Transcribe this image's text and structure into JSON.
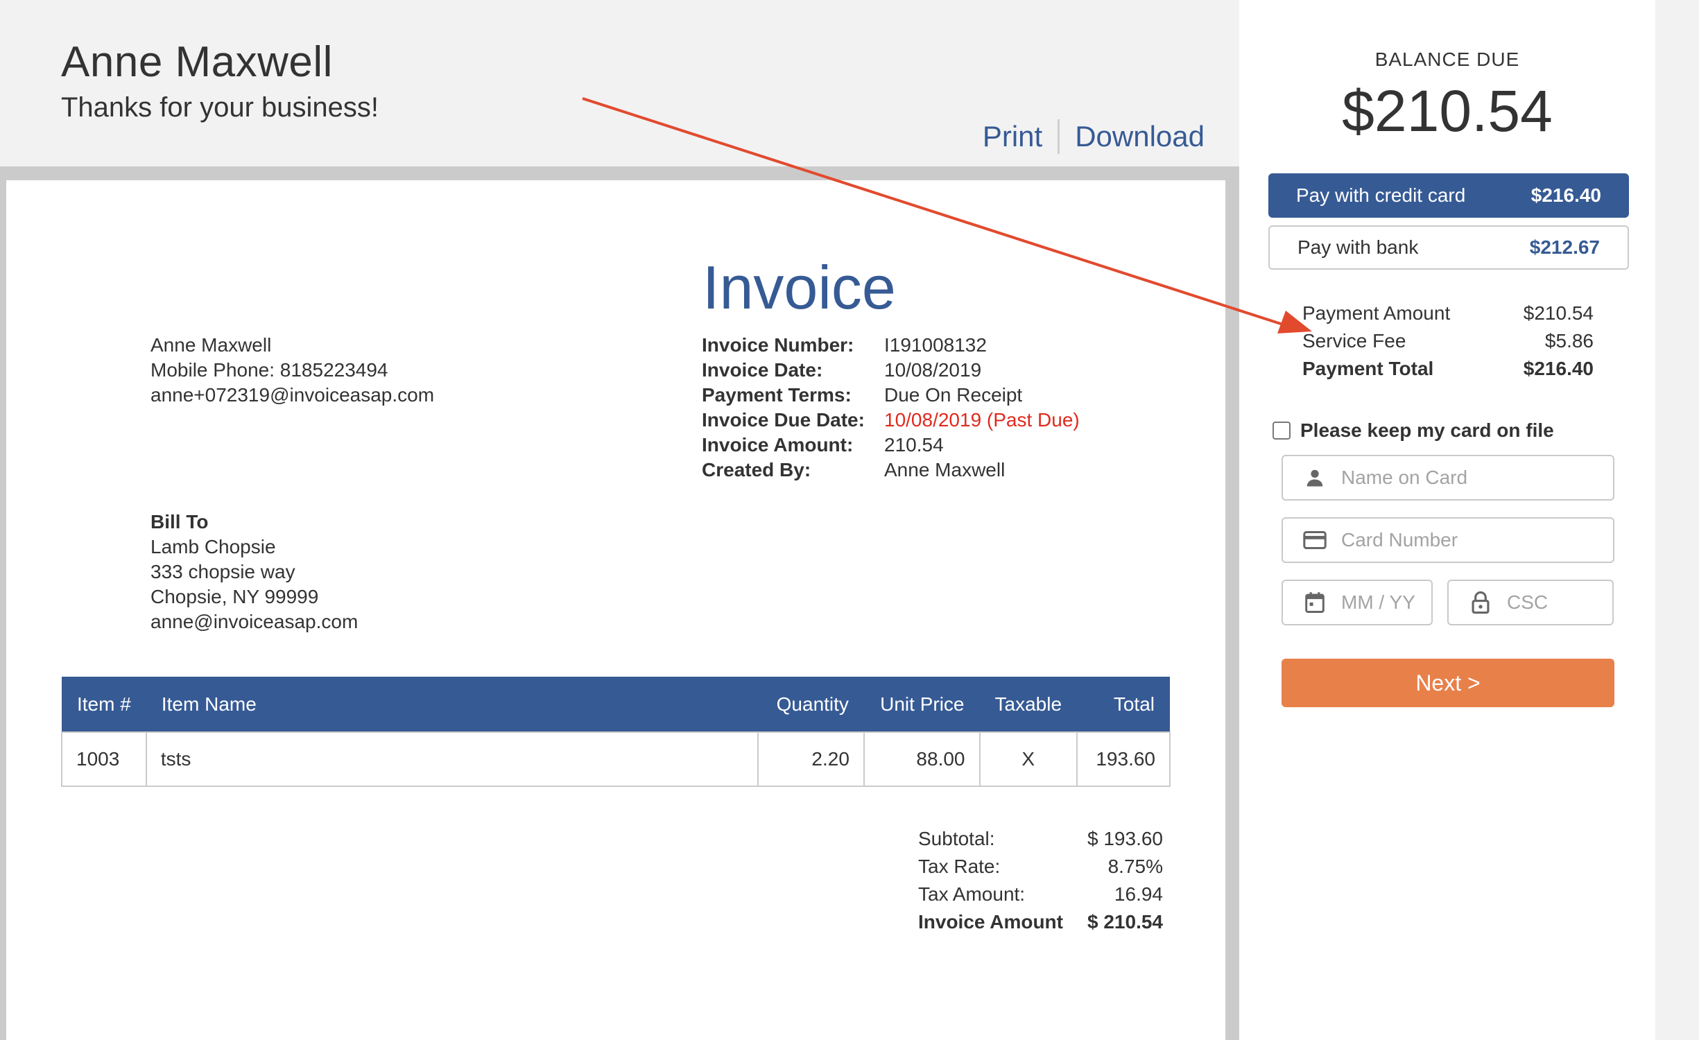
{
  "header": {
    "business_name": "Anne Maxwell",
    "tagline": "Thanks for your business!",
    "print_label": "Print",
    "download_label": "Download"
  },
  "invoice": {
    "title": "Invoice",
    "from": {
      "name": "Anne Maxwell",
      "phone": "Mobile Phone: 8185223494",
      "email": "anne+072319@invoiceasap.com"
    },
    "meta": [
      {
        "label": "Invoice Number:",
        "value": "I191008132"
      },
      {
        "label": "Invoice Date:",
        "value": "10/08/2019"
      },
      {
        "label": "Payment Terms:",
        "value": "Due On Receipt"
      },
      {
        "label": "Invoice Due Date:",
        "value": "10/08/2019 (Past Due)"
      },
      {
        "label": "Invoice Amount:",
        "value": "210.54"
      },
      {
        "label": "Created By:",
        "value": "Anne Maxwell"
      }
    ],
    "bill_to": {
      "heading": "Bill To",
      "name": "Lamb Chopsie",
      "street": "333 chopsie way",
      "city": "Chopsie, NY 99999",
      "email": "anne@invoiceasap.com"
    },
    "table": {
      "headers": [
        "Item #",
        "Item Name",
        "Quantity",
        "Unit Price",
        "Taxable",
        "Total"
      ],
      "rows": [
        [
          "1003",
          "tsts",
          "2.20",
          "88.00",
          "X",
          "193.60"
        ]
      ]
    },
    "totals": [
      {
        "label": "Subtotal:",
        "value": "$ 193.60"
      },
      {
        "label": "Tax Rate:",
        "value": "8.75%"
      },
      {
        "label": "Tax Amount:",
        "value": "16.94"
      },
      {
        "label": "Invoice Amount",
        "value": "$ 210.54"
      }
    ]
  },
  "payment": {
    "balance_label": "BALANCE DUE",
    "balance_amount": "$210.54",
    "credit": {
      "label": "Pay with credit card",
      "amount": "$216.40"
    },
    "bank": {
      "label": "Pay with bank",
      "amount": "$212.67"
    },
    "summary": [
      {
        "label": "Payment Amount",
        "value": "$210.54"
      },
      {
        "label": "Service Fee",
        "value": "$5.86"
      },
      {
        "label": "Payment Total",
        "value": "$216.40"
      }
    ],
    "keep_card_label": "Please keep my card on file",
    "fields": {
      "name_placeholder": "Name on Card",
      "card_placeholder": "Card Number",
      "expiry_placeholder": "MM / YY",
      "csc_placeholder": "CSC"
    },
    "next_label": "Next >"
  },
  "colors": {
    "brand_blue": "#365a94",
    "past_due_red": "#e02a1e",
    "next_orange": "#e8804a",
    "annotation_arrow": "#e24a2e"
  }
}
